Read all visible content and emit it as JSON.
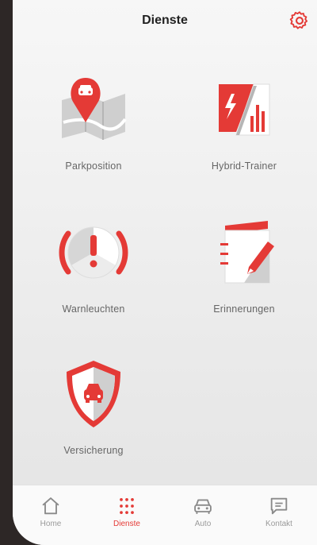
{
  "header": {
    "title": "Dienste"
  },
  "services": [
    {
      "label": "Parkposition"
    },
    {
      "label": "Hybrid-Trainer"
    },
    {
      "label": "Warnleuchten"
    },
    {
      "label": "Erinnerungen"
    },
    {
      "label": "Versicherung"
    }
  ],
  "tabbar": {
    "items": [
      {
        "label": "Home",
        "icon": "home-icon"
      },
      {
        "label": "Dienste",
        "icon": "grid-icon",
        "active": true
      },
      {
        "label": "Auto",
        "icon": "car-icon"
      },
      {
        "label": "Kontakt",
        "icon": "chat-icon"
      }
    ]
  },
  "colors": {
    "accent": "#e43a36",
    "inactive": "#9a9a9a"
  }
}
